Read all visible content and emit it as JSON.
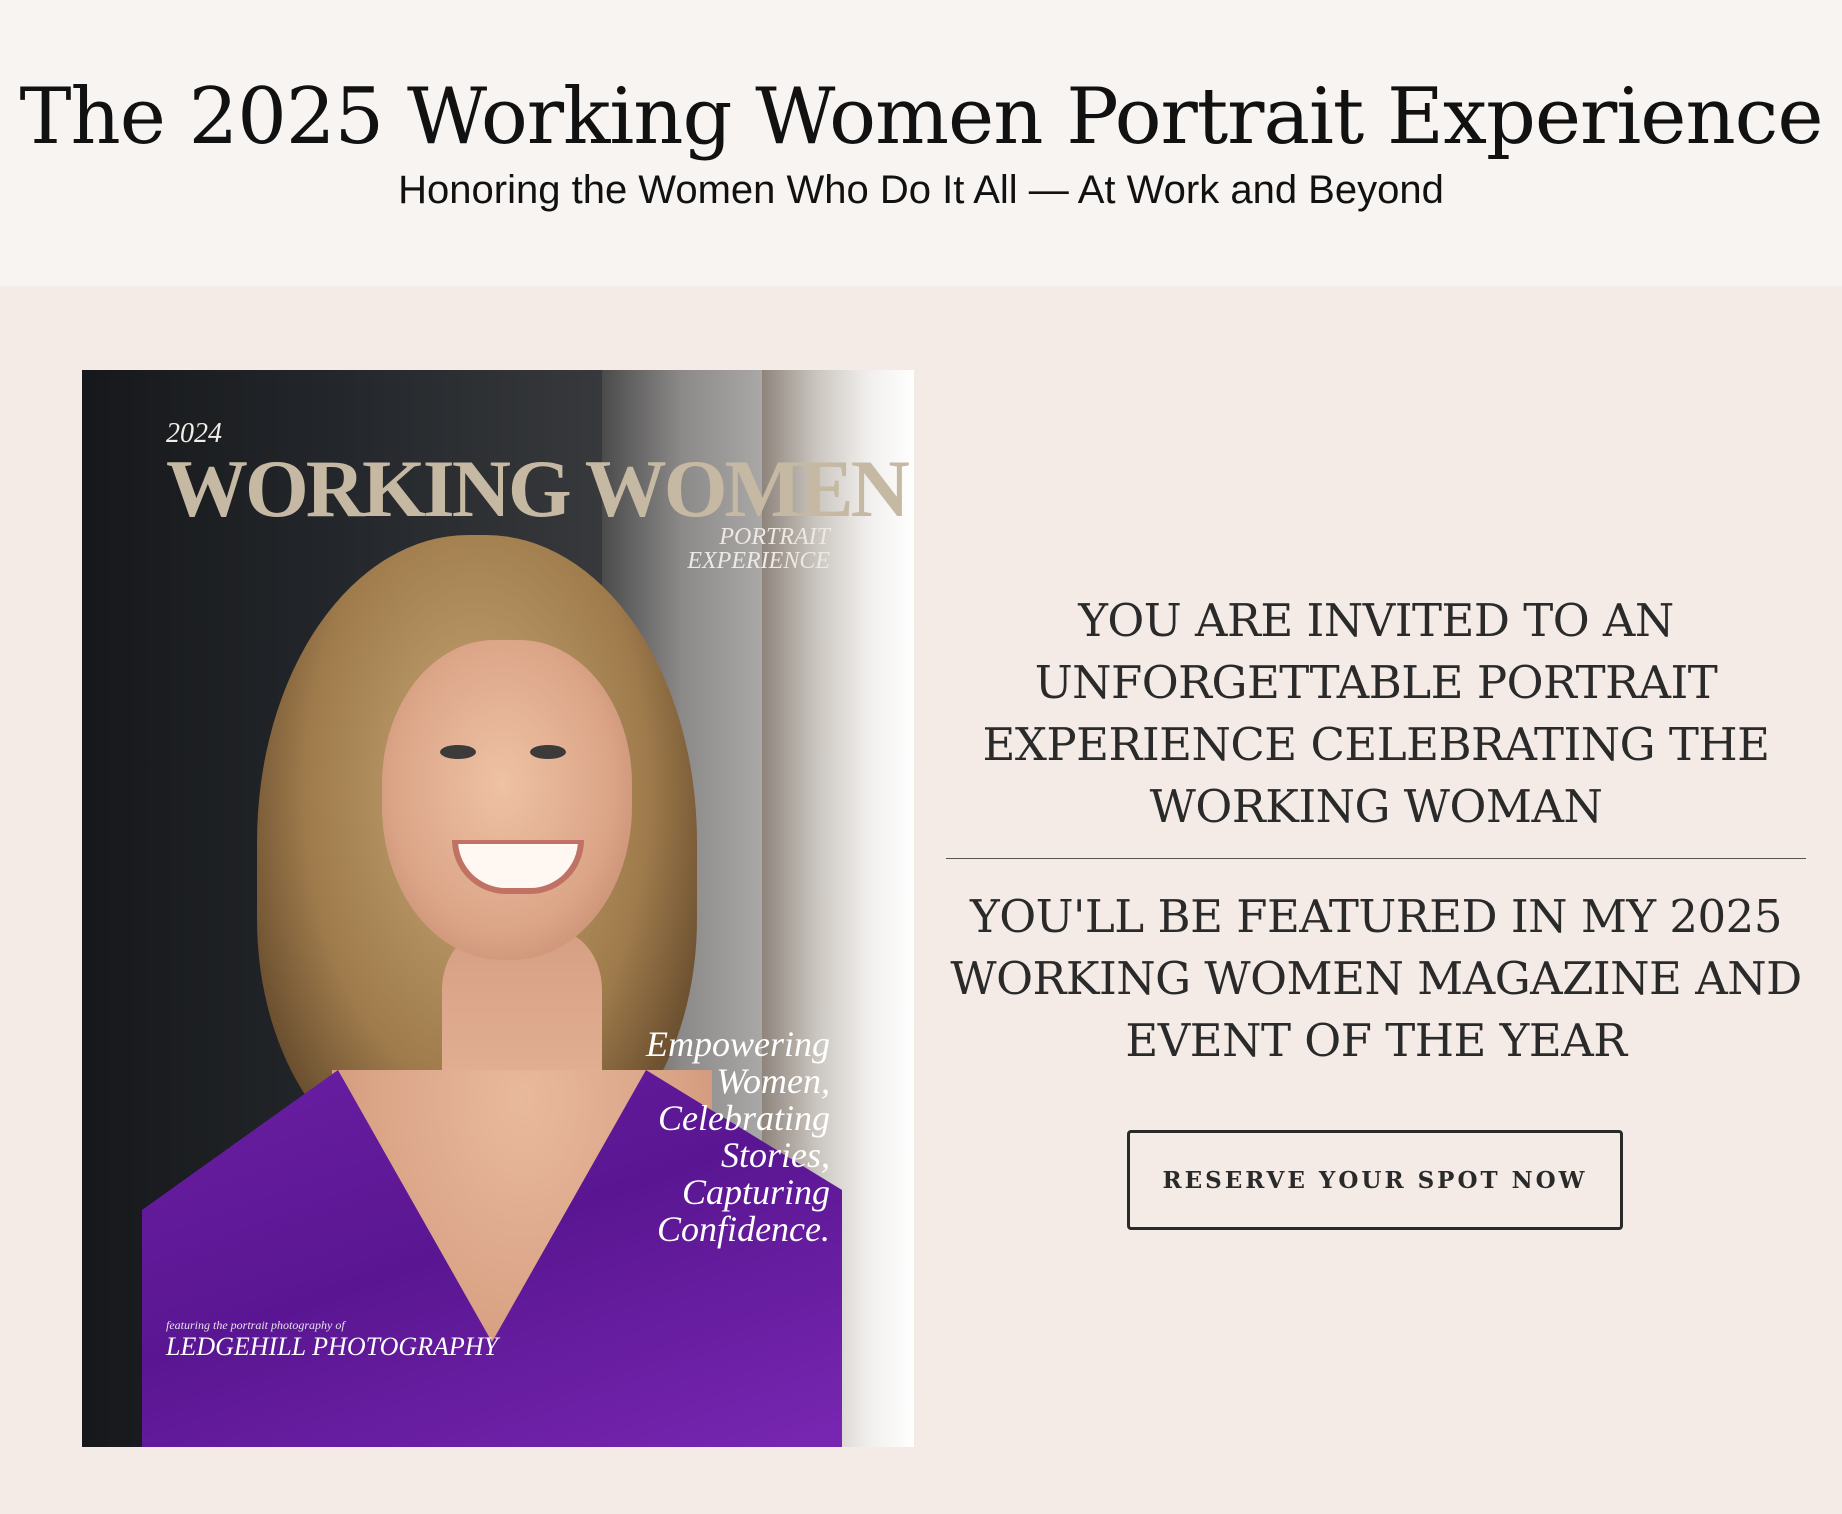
{
  "header": {
    "title": "The 2025 Working Women Portrait Experience",
    "subtitle": "Honoring the Women Who Do It All — At Work and Beyond"
  },
  "cover": {
    "year": "2024",
    "title": "WORKING WOMEN",
    "subtitle_line1": "PORTRAIT",
    "subtitle_line2": "EXPERIENCE",
    "tagline": [
      "Empowering",
      "Women,",
      "Celebrating",
      "Stories,",
      "Capturing",
      "Confidence."
    ],
    "featuring": "featuring the portrait photography of",
    "photographer": "LEDGEHILL PHOTOGRAPHY",
    "title_color": "#c6b9a3",
    "dress_color": "#6a1fa3"
  },
  "invite": {
    "heading": "YOU ARE INVITED TO AN UNFORGETTABLE PORTRAIT EXPERIENCE CELEBRATING THE WORKING WOMAN",
    "feature": "YOU'LL BE FEATURED IN MY 2025 WORKING WOMEN MAGAZINE AND EVENT OF THE YEAR",
    "button_label": "RESERVE YOUR SPOT NOW"
  },
  "colors": {
    "header_bg": "#f7f4f2",
    "main_bg": "#f4ebe7",
    "text": "#2a2a2a"
  }
}
